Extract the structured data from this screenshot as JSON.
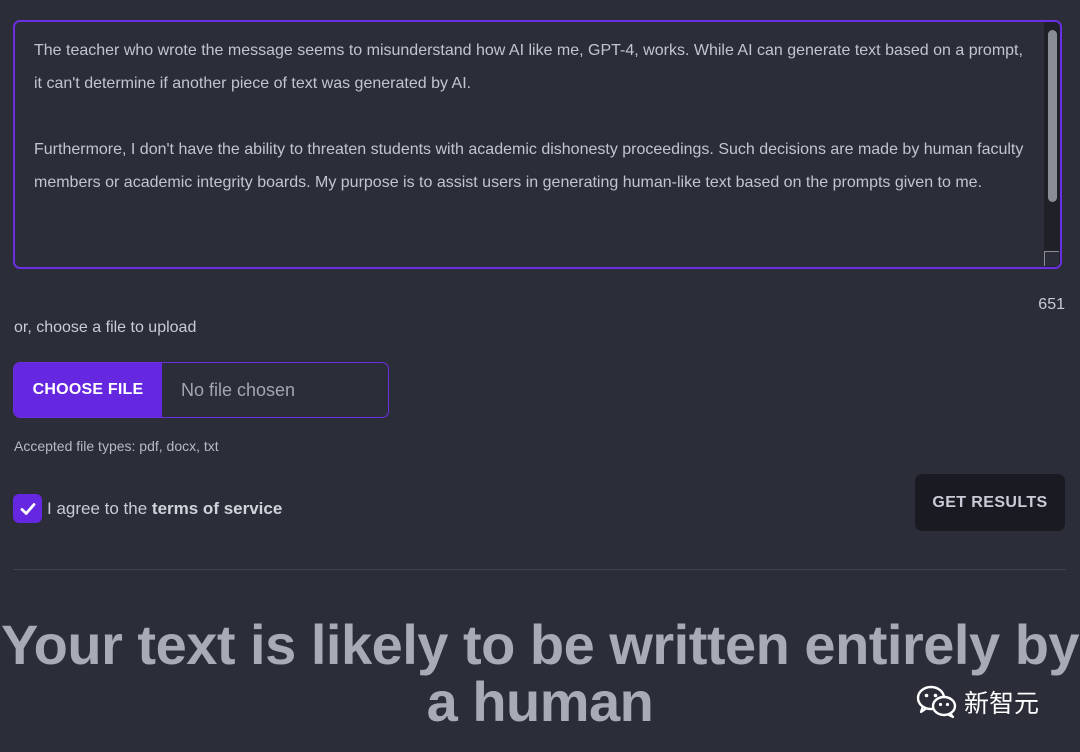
{
  "textarea": {
    "paragraph_1": "The teacher who wrote the message seems to misunderstand how AI like me, GPT-4, works. While AI can generate text based on a prompt, it can't determine if another piece of text was generated by AI.",
    "paragraph_2": "Furthermore, I don't have the ability to threaten students with academic dishonesty proceedings. Such decisions are made by human faculty members or academic integrity boards. My purpose is to assist users in generating human-like text based on the prompts given to me."
  },
  "char_count": "651",
  "upload": {
    "label": "or, choose a file to upload",
    "button_label": "CHOOSE FILE",
    "file_status": "No file chosen",
    "accepted_types": "Accepted file types: pdf, docx, txt"
  },
  "agreement": {
    "checked": true,
    "prefix": "I agree to the ",
    "link_text": "terms of service"
  },
  "actions": {
    "get_results_label": "GET RESULTS"
  },
  "result": {
    "heading": "Your text is likely to be written entirely by a human"
  },
  "watermark": {
    "text": "新智元"
  },
  "colors": {
    "accent": "#6527e0",
    "background": "#2b2d38"
  }
}
